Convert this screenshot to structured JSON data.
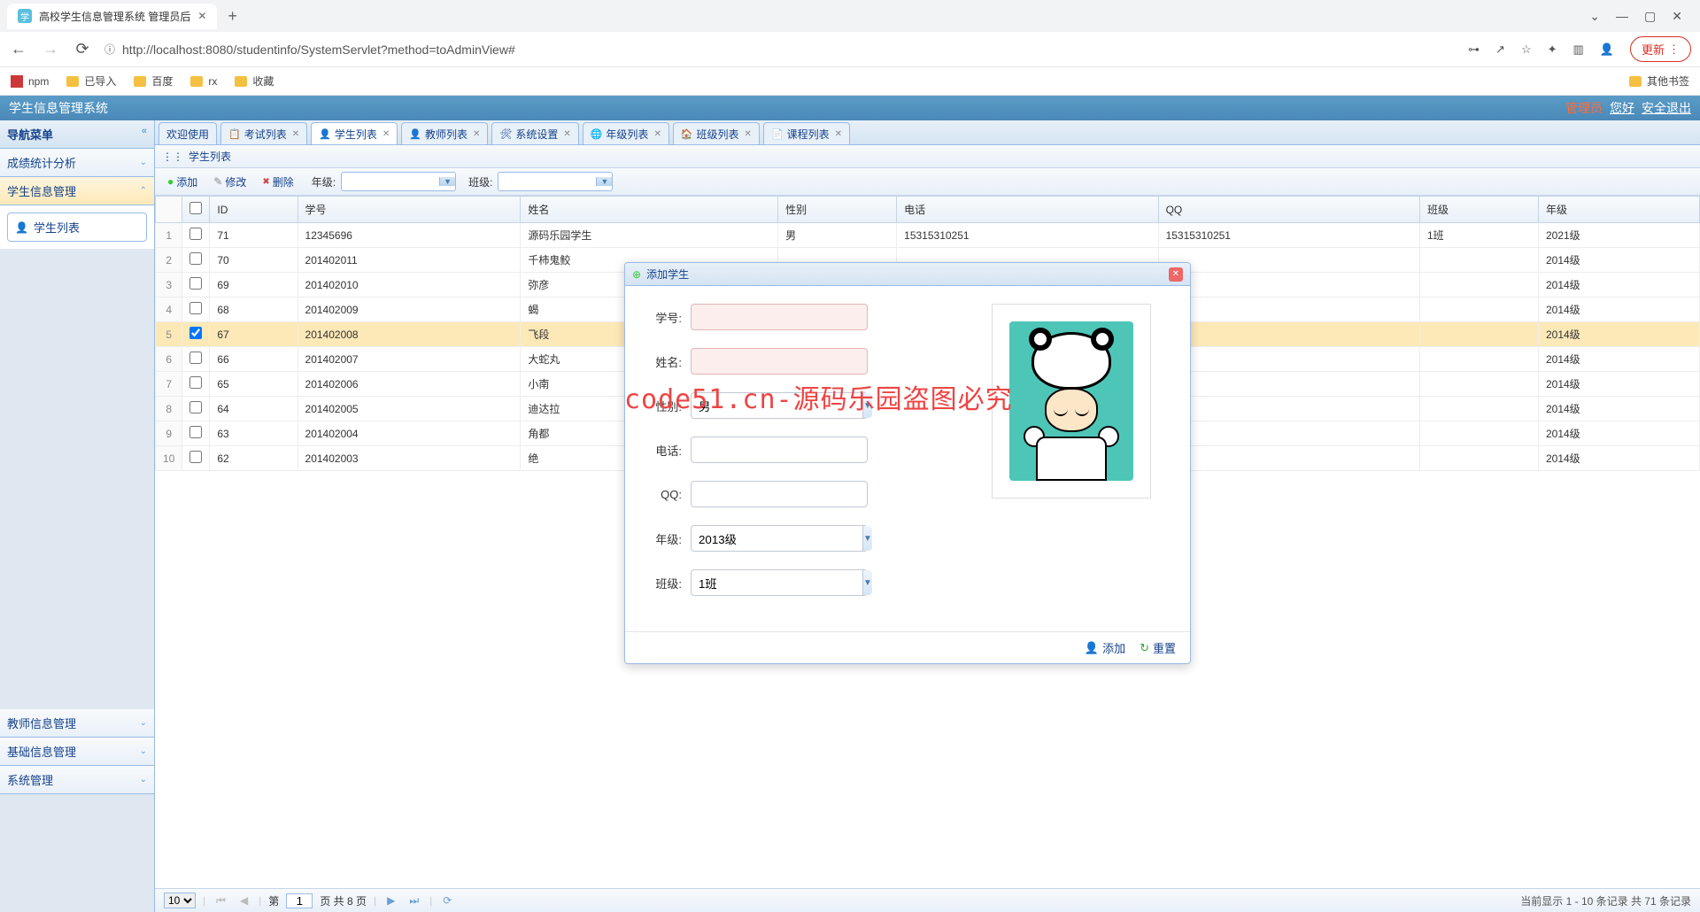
{
  "browser": {
    "tab_title": "高校学生信息管理系统 管理员后",
    "url": "http://localhost:8080/studentinfo/SystemServlet?method=toAdminView#",
    "update_label": "更新",
    "bookmarks": [
      "npm",
      "已导入",
      "百度",
      "rx",
      "收藏"
    ],
    "other_bookmarks": "其他书签"
  },
  "app": {
    "title": "学生信息管理系统",
    "role": "管理员",
    "greeting": "您好",
    "logout": "安全退出"
  },
  "sidebar": {
    "header": "导航菜单",
    "items": [
      {
        "label": "成绩统计分析",
        "expanded": false
      },
      {
        "label": "学生信息管理",
        "expanded": true,
        "children": [
          {
            "label": "学生列表"
          }
        ]
      },
      {
        "label": "教师信息管理",
        "expanded": false
      },
      {
        "label": "基础信息管理",
        "expanded": false
      },
      {
        "label": "系统管理",
        "expanded": false
      }
    ]
  },
  "tabs": [
    {
      "label": "欢迎使用",
      "icon": ""
    },
    {
      "label": "考试列表",
      "icon": "📋"
    },
    {
      "label": "学生列表",
      "icon": "👤",
      "active": true
    },
    {
      "label": "教师列表",
      "icon": "👤"
    },
    {
      "label": "系统设置",
      "icon": "🛠"
    },
    {
      "label": "年级列表",
      "icon": "🌐"
    },
    {
      "label": "班级列表",
      "icon": "🏠"
    },
    {
      "label": "课程列表",
      "icon": "📄"
    }
  ],
  "panel": {
    "title": "学生列表"
  },
  "toolbar": {
    "add": "添加",
    "edit": "修改",
    "delete": "删除",
    "grade_label": "年级:",
    "class_label": "班级:"
  },
  "columns": [
    "",
    "",
    "ID",
    "学号",
    "姓名",
    "性别",
    "电话",
    "QQ",
    "班级",
    "年级"
  ],
  "rows": [
    {
      "n": 1,
      "chk": false,
      "id": "71",
      "sn": "12345696",
      "name": "源码乐园学生",
      "sex": "男",
      "tel": "15315310251",
      "qq": "15315310251",
      "cls": "1班",
      "grade": "2021级"
    },
    {
      "n": 2,
      "chk": false,
      "id": "70",
      "sn": "201402011",
      "name": "千柿鬼鲛",
      "sex": "",
      "tel": "",
      "qq": "",
      "cls": "",
      "grade": "2014级"
    },
    {
      "n": 3,
      "chk": false,
      "id": "69",
      "sn": "201402010",
      "name": "弥彦",
      "sex": "",
      "tel": "",
      "qq": "",
      "cls": "",
      "grade": "2014级"
    },
    {
      "n": 4,
      "chk": false,
      "id": "68",
      "sn": "201402009",
      "name": "蝎",
      "sex": "",
      "tel": "",
      "qq": "",
      "cls": "",
      "grade": "2014级"
    },
    {
      "n": 5,
      "chk": true,
      "id": "67",
      "sn": "201402008",
      "name": "飞段",
      "sex": "",
      "tel": "",
      "qq": "",
      "cls": "",
      "grade": "2014级"
    },
    {
      "n": 6,
      "chk": false,
      "id": "66",
      "sn": "201402007",
      "name": "大蛇丸",
      "sex": "",
      "tel": "",
      "qq": "",
      "cls": "",
      "grade": "2014级"
    },
    {
      "n": 7,
      "chk": false,
      "id": "65",
      "sn": "201402006",
      "name": "小南",
      "sex": "",
      "tel": "",
      "qq": "",
      "cls": "",
      "grade": "2014级"
    },
    {
      "n": 8,
      "chk": false,
      "id": "64",
      "sn": "201402005",
      "name": "迪达拉",
      "sex": "",
      "tel": "",
      "qq": "",
      "cls": "",
      "grade": "2014级"
    },
    {
      "n": 9,
      "chk": false,
      "id": "63",
      "sn": "201402004",
      "name": "角都",
      "sex": "",
      "tel": "",
      "qq": "",
      "cls": "",
      "grade": "2014级"
    },
    {
      "n": 10,
      "chk": false,
      "id": "62",
      "sn": "201402003",
      "name": "绝",
      "sex": "",
      "tel": "",
      "qq": "",
      "cls": "",
      "grade": "2014级"
    }
  ],
  "paging": {
    "page_size": "10",
    "page_label_prefix": "第",
    "page_value": "1",
    "page_label_suffix": "页 共 8 页",
    "status": "当前显示 1 - 10 条记录 共 71 条记录"
  },
  "dialog": {
    "title": "添加学生",
    "fields": {
      "sn": "学号:",
      "name": "姓名:",
      "sex": "性别:",
      "sex_value": "男",
      "tel": "电话:",
      "qq": "QQ:",
      "grade": "年级:",
      "grade_value": "2013级",
      "cls": "班级:",
      "cls_value": "1班"
    },
    "add_btn": "添加",
    "reset_btn": "重置"
  },
  "watermark": "code51.cn-源码乐园盗图必究"
}
